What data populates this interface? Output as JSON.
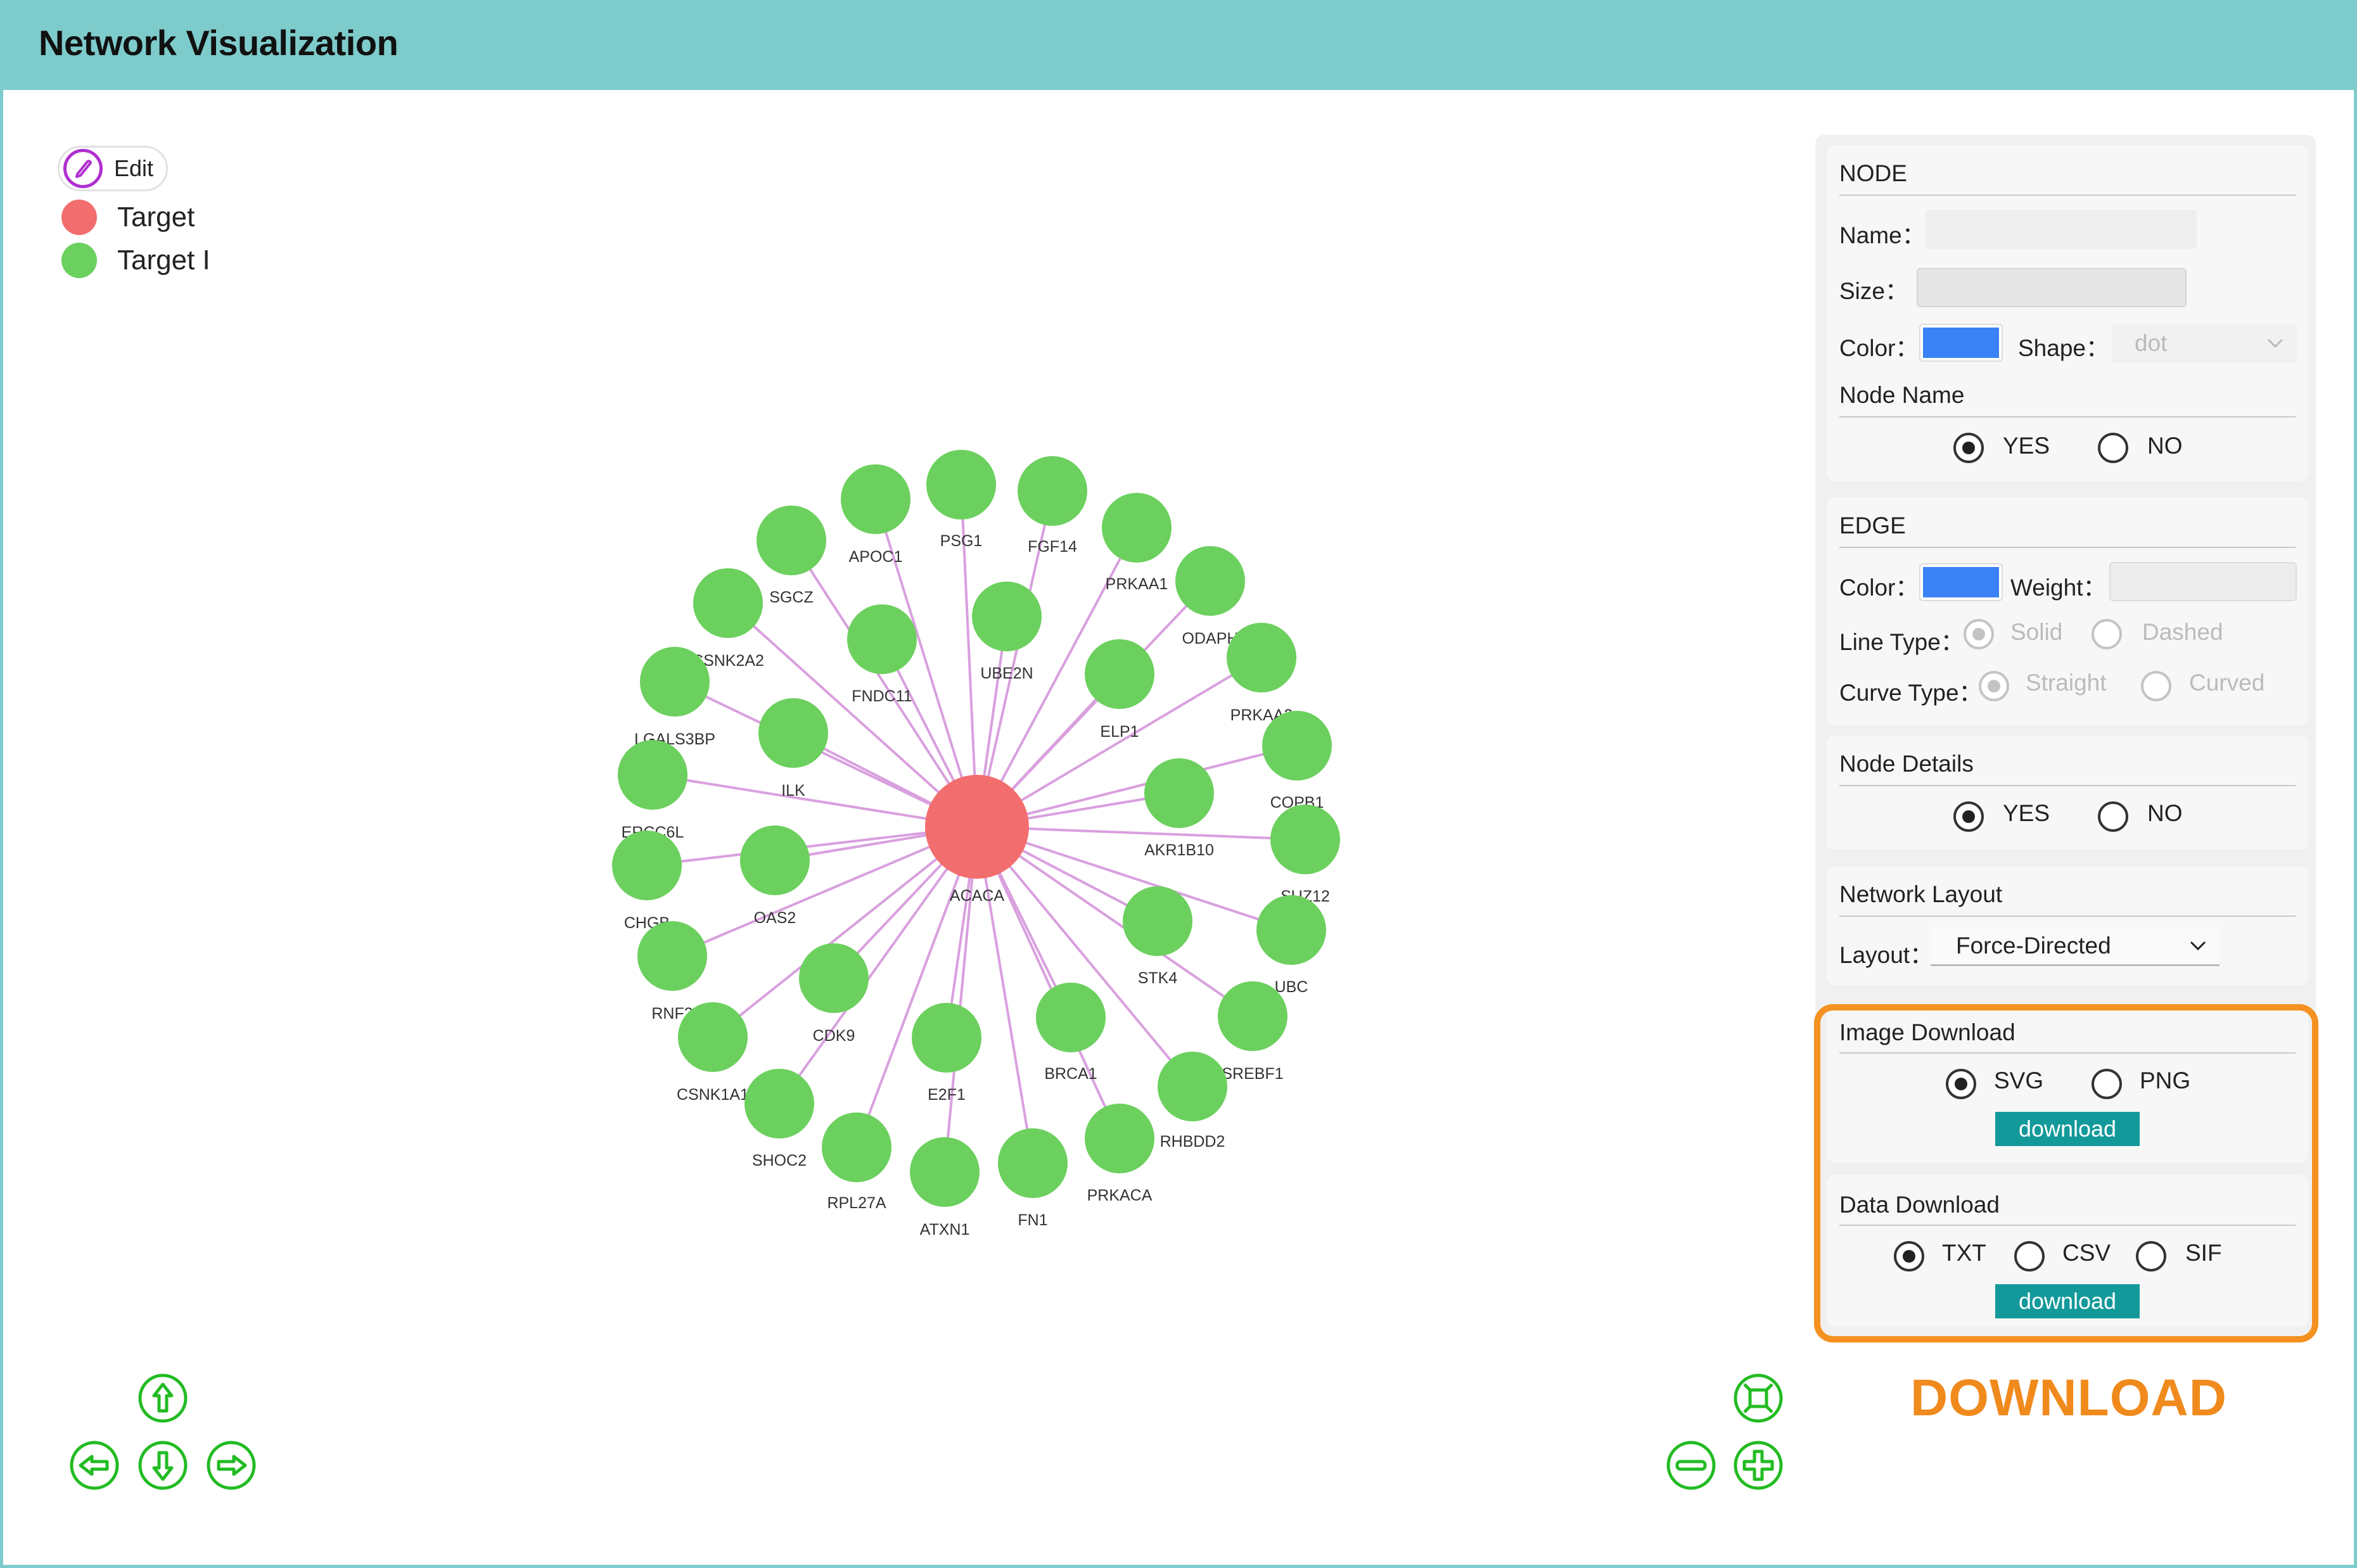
{
  "header": {
    "title": "Network Visualization"
  },
  "legend": {
    "edit_label": "Edit",
    "items": [
      {
        "label": "Target",
        "color": "#f26d6d"
      },
      {
        "label": "Target I",
        "color": "#6cd05e"
      }
    ]
  },
  "graph": {
    "center": {
      "label": "ACACA",
      "color": "#f26d6d"
    },
    "node_color": "#6cd05e",
    "edge_color": "#d9a0df",
    "nodes": [
      "APOC1",
      "PSG1",
      "FGF14",
      "PRKAA1",
      "ODAPH",
      "SGCZ",
      "UBE2N",
      "FNDC11",
      "CSNK2A2",
      "ELP1",
      "PRKAA2",
      "LGALS3BP",
      "ILK",
      "COPB1",
      "AKR1B10",
      "ERCC6L",
      "SUZ12",
      "CHGB",
      "OAS2",
      "STK4",
      "UBC",
      "RNF2",
      "CDK9",
      "SREBF1",
      "CSNK1A1",
      "E2F1",
      "BRCA1",
      "RHBDD2",
      "SHOC2",
      "RPL27A",
      "ATXN1",
      "FN1",
      "PRKACA"
    ]
  },
  "nav": {
    "icons": [
      "arrow-up-icon",
      "arrow-left-icon",
      "arrow-down-icon",
      "arrow-right-icon",
      "fit-view-icon",
      "zoom-out-icon",
      "zoom-in-icon"
    ]
  },
  "panel": {
    "node": {
      "title": "NODE",
      "name_label": "Name：",
      "size_label": "Size：",
      "color_label": "Color：",
      "color_value": "#3b82f6",
      "shape_label": "Shape：",
      "shape_value": "dot",
      "node_name_title": "Node Name",
      "yes": "YES",
      "no": "NO"
    },
    "edge": {
      "title": "EDGE",
      "color_label": "Color：",
      "color_value": "#3b82f6",
      "weight_label": "Weight：",
      "line_type_label": "Line Type：",
      "solid": "Solid",
      "dashed": "Dashed",
      "curve_type_label": "Curve Type：",
      "straight": "Straight",
      "curved": "Curved"
    },
    "node_details": {
      "title": "Node Details",
      "yes": "YES",
      "no": "NO"
    },
    "network_layout": {
      "title": "Network Layout",
      "layout_label": "Layout：",
      "layout_value": "Force-Directed"
    },
    "image_download": {
      "title": "Image Download",
      "svg": "SVG",
      "png": "PNG",
      "button": "download"
    },
    "data_download": {
      "title": "Data Download",
      "txt": "TXT",
      "csv": "CSV",
      "sif": "SIF",
      "button": "download"
    },
    "highlight_color": "#f59120"
  },
  "caption": "DOWNLOAD"
}
